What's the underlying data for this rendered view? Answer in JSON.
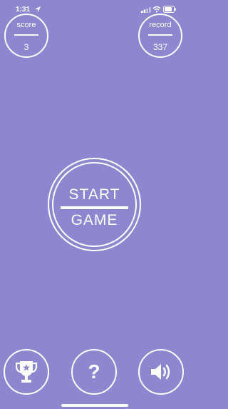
{
  "status_bar": {
    "time": "1:31"
  },
  "score": {
    "label": "score",
    "value": "3"
  },
  "record": {
    "label": "record",
    "value": "337"
  },
  "start_button": {
    "line1": "START",
    "line2": "GAME"
  },
  "bottom_buttons": {
    "leaderboard_icon": "trophy-icon",
    "help_label": "?",
    "sound_icon": "speaker-icon"
  },
  "colors": {
    "background": "#8e87cf",
    "foreground": "#ffffff"
  }
}
